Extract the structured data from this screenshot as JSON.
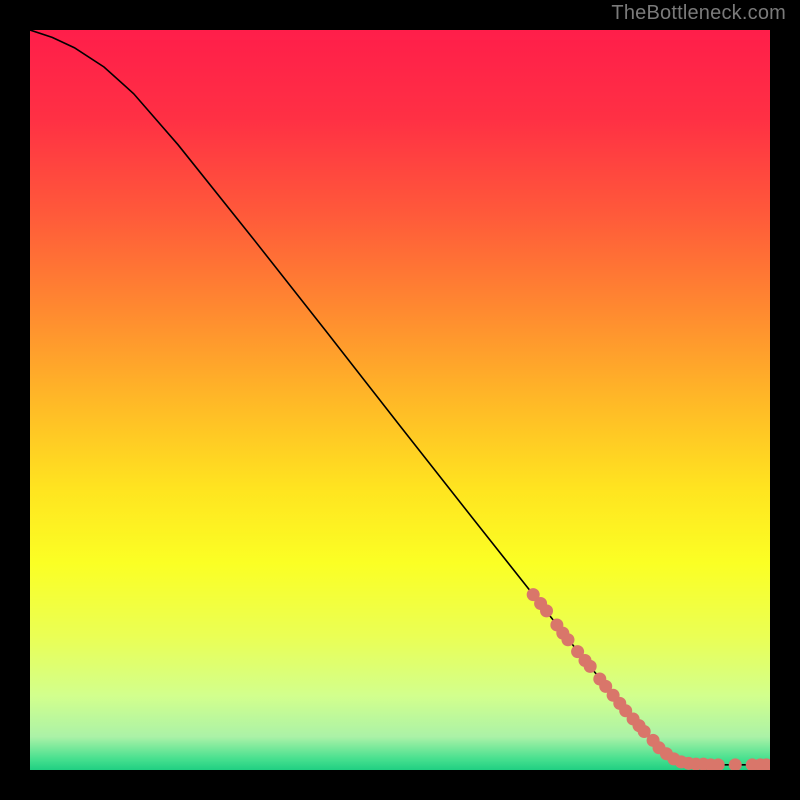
{
  "watermark": "TheBottleneck.com",
  "chart_data": {
    "type": "line",
    "title": "",
    "xlabel": "",
    "ylabel": "",
    "xlim": [
      0,
      100
    ],
    "ylim": [
      0,
      100
    ],
    "grid": false,
    "legend": false,
    "background_gradient": {
      "stops": [
        {
          "pos": 0.0,
          "color": "#ff1e4a"
        },
        {
          "pos": 0.12,
          "color": "#ff3044"
        },
        {
          "pos": 0.25,
          "color": "#ff5a3a"
        },
        {
          "pos": 0.38,
          "color": "#ff8a30"
        },
        {
          "pos": 0.5,
          "color": "#ffb827"
        },
        {
          "pos": 0.62,
          "color": "#ffe420"
        },
        {
          "pos": 0.72,
          "color": "#fbff24"
        },
        {
          "pos": 0.82,
          "color": "#eaff55"
        },
        {
          "pos": 0.9,
          "color": "#d2ff8d"
        },
        {
          "pos": 0.955,
          "color": "#abf2a7"
        },
        {
          "pos": 0.985,
          "color": "#47e08f"
        },
        {
          "pos": 1.0,
          "color": "#20cf82"
        }
      ]
    },
    "curve": [
      {
        "x": 0,
        "y": 100.0
      },
      {
        "x": 3,
        "y": 99.0
      },
      {
        "x": 6,
        "y": 97.6
      },
      {
        "x": 10,
        "y": 95.0
      },
      {
        "x": 14,
        "y": 91.4
      },
      {
        "x": 20,
        "y": 84.5
      },
      {
        "x": 30,
        "y": 72.0
      },
      {
        "x": 40,
        "y": 59.3
      },
      {
        "x": 50,
        "y": 46.5
      },
      {
        "x": 60,
        "y": 33.8
      },
      {
        "x": 68,
        "y": 23.7
      },
      {
        "x": 75,
        "y": 14.8
      },
      {
        "x": 80,
        "y": 8.8
      },
      {
        "x": 84,
        "y": 4.3
      },
      {
        "x": 86.5,
        "y": 2.0
      },
      {
        "x": 88,
        "y": 1.2
      },
      {
        "x": 90,
        "y": 0.8
      },
      {
        "x": 93,
        "y": 0.7
      },
      {
        "x": 96,
        "y": 0.7
      },
      {
        "x": 100,
        "y": 0.7
      }
    ],
    "points": [
      {
        "x": 68.0,
        "y": 23.7
      },
      {
        "x": 69.0,
        "y": 22.5
      },
      {
        "x": 69.8,
        "y": 21.5
      },
      {
        "x": 71.2,
        "y": 19.6
      },
      {
        "x": 72.0,
        "y": 18.5
      },
      {
        "x": 72.7,
        "y": 17.6
      },
      {
        "x": 74.0,
        "y": 16.0
      },
      {
        "x": 75.0,
        "y": 14.8
      },
      {
        "x": 75.7,
        "y": 14.0
      },
      {
        "x": 77.0,
        "y": 12.3
      },
      {
        "x": 77.8,
        "y": 11.3
      },
      {
        "x": 78.8,
        "y": 10.1
      },
      {
        "x": 79.7,
        "y": 9.0
      },
      {
        "x": 80.5,
        "y": 8.0
      },
      {
        "x": 81.5,
        "y": 6.9
      },
      {
        "x": 82.3,
        "y": 6.0
      },
      {
        "x": 83.0,
        "y": 5.2
      },
      {
        "x": 84.2,
        "y": 4.0
      },
      {
        "x": 85.0,
        "y": 3.0
      },
      {
        "x": 86.0,
        "y": 2.2
      },
      {
        "x": 87.0,
        "y": 1.5
      },
      {
        "x": 88.0,
        "y": 1.1
      },
      {
        "x": 89.0,
        "y": 0.9
      },
      {
        "x": 90.0,
        "y": 0.8
      },
      {
        "x": 91.0,
        "y": 0.8
      },
      {
        "x": 92.0,
        "y": 0.7
      },
      {
        "x": 93.0,
        "y": 0.7
      },
      {
        "x": 95.3,
        "y": 0.7
      },
      {
        "x": 97.6,
        "y": 0.7
      },
      {
        "x": 98.7,
        "y": 0.7
      },
      {
        "x": 99.5,
        "y": 0.7
      }
    ],
    "point_color": "#d9766a",
    "line_color": "#000000"
  }
}
